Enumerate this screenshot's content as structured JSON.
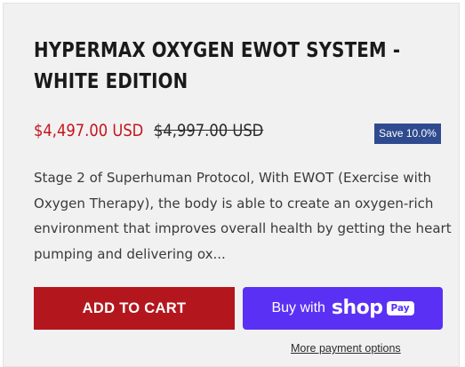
{
  "product": {
    "title": "HYPERMAX OXYGEN EWOT SYSTEM - WHITE EDITION",
    "sale_price": "$4,497.00 USD",
    "compare_price": "$4,997.00 USD",
    "save_badge": "Save 10.0%",
    "description": "Stage 2 of Superhuman Protocol, With EWOT (Exercise with Oxygen Therapy), the body is able to create an oxygen-rich environment that improves overall health by getting the heart pumping and delivering ox..."
  },
  "actions": {
    "add_to_cart": "ADD TO CART",
    "buy_with": "Buy with",
    "shop_logo": "shop",
    "pay_badge": "Pay",
    "more_payment_options": "More payment options"
  },
  "colors": {
    "sale_price": "#c4161c",
    "add_to_cart_bg": "#b3171d",
    "shop_pay_bg": "#5a31f4",
    "save_badge_bg": "#2f4a8f",
    "card_bg": "#f1f1f2"
  }
}
